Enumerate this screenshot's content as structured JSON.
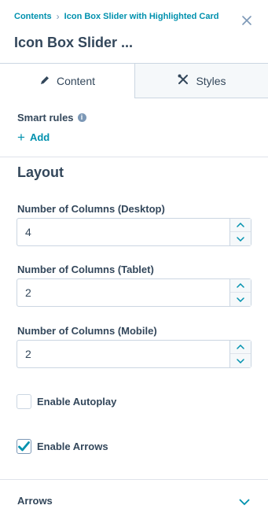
{
  "breadcrumb": {
    "root": "Contents",
    "current": "Icon Box Slider with Highlighted Card",
    "separator_icon": "chevron-right-icon"
  },
  "panel": {
    "title": "Icon Box Slider ...",
    "close_icon": "close-icon"
  },
  "tabs": [
    {
      "label": "Content",
      "icon": "pencil-icon",
      "active": true
    },
    {
      "label": "Styles",
      "icon": "tools-icon",
      "active": false
    }
  ],
  "smart_rules": {
    "label": "Smart rules",
    "info_icon": "info-icon",
    "add_label": "Add"
  },
  "layout": {
    "heading": "Layout",
    "fields": [
      {
        "label": "Number of Columns (Desktop)",
        "value": "4"
      },
      {
        "label": "Number of Columns (Tablet)",
        "value": "2"
      },
      {
        "label": "Number of Columns (Mobile)",
        "value": "2"
      }
    ],
    "checkboxes": [
      {
        "label": "Enable Autoplay",
        "checked": false
      },
      {
        "label": "Enable Arrows",
        "checked": true
      }
    ]
  },
  "arrows_section": {
    "label": "Arrows",
    "expanded": false
  },
  "colors": {
    "link": "#0091ae",
    "text": "#33475b",
    "border": "#cbd6e2",
    "tab_inactive_bg": "#f5f8fa"
  }
}
